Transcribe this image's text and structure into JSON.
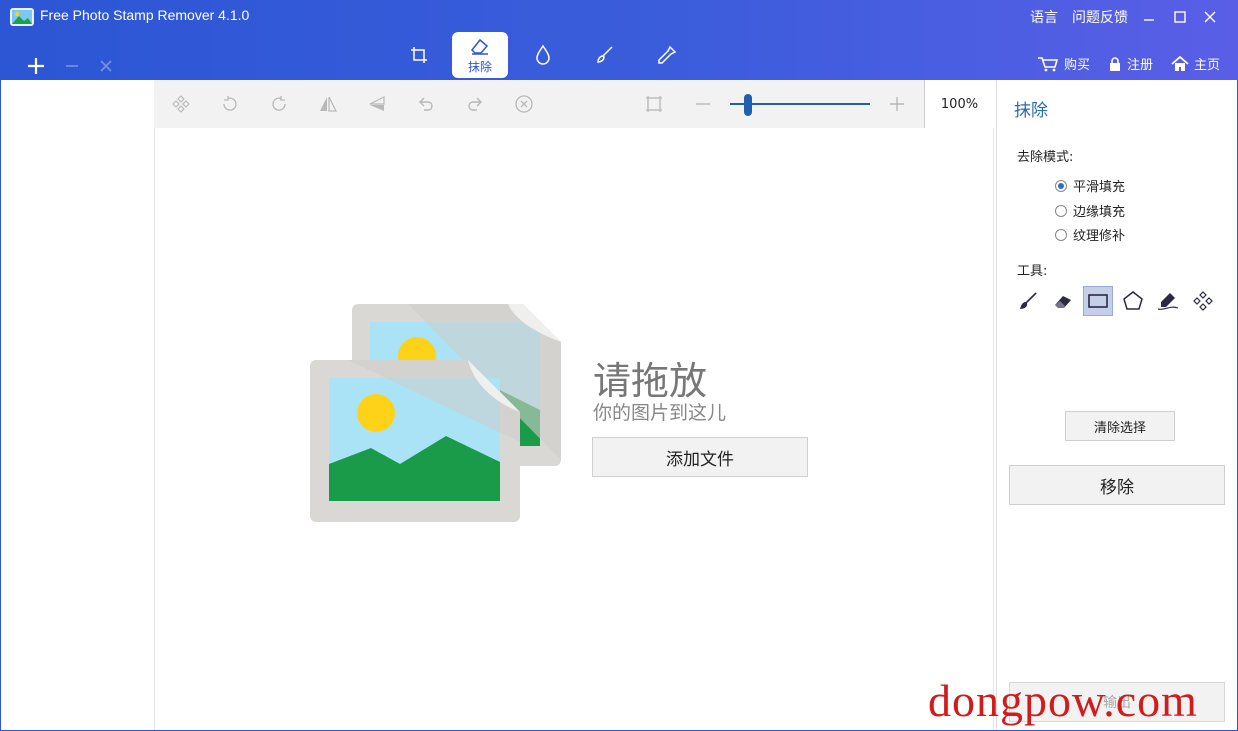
{
  "window": {
    "title": "Free Photo Stamp Remover 4.1.0",
    "top_links": [
      "语言",
      "问题反馈"
    ]
  },
  "header": {
    "active_tab_label": "抹除",
    "links": [
      {
        "label": "购买",
        "icon": "cart-icon"
      },
      {
        "label": "注册",
        "icon": "lock-icon"
      },
      {
        "label": "主页",
        "icon": "home-icon"
      }
    ]
  },
  "toolbar": {
    "zoom_percent": "100%",
    "zoom_level": 0.13
  },
  "canvas": {
    "drop_title": "请拖放",
    "drop_subtitle": "你的图片到这儿",
    "add_file_label": "添加文件"
  },
  "panel": {
    "title": "抹除",
    "mode_label": "去除模式:",
    "modes": [
      {
        "label": "平滑填充",
        "selected": true
      },
      {
        "label": "边缘填充",
        "selected": false
      },
      {
        "label": "纹理修补",
        "selected": false
      }
    ],
    "tools_label": "工具:",
    "clear_selection_label": "清除选择",
    "remove_label": "移除",
    "export_label": "输出"
  },
  "watermark": "dongpow.com",
  "colors": {
    "header_start": "#2c56d4",
    "header_end": "#5a5ee6",
    "accent": "#2c6ab0",
    "watermark": "#d21c1c"
  }
}
